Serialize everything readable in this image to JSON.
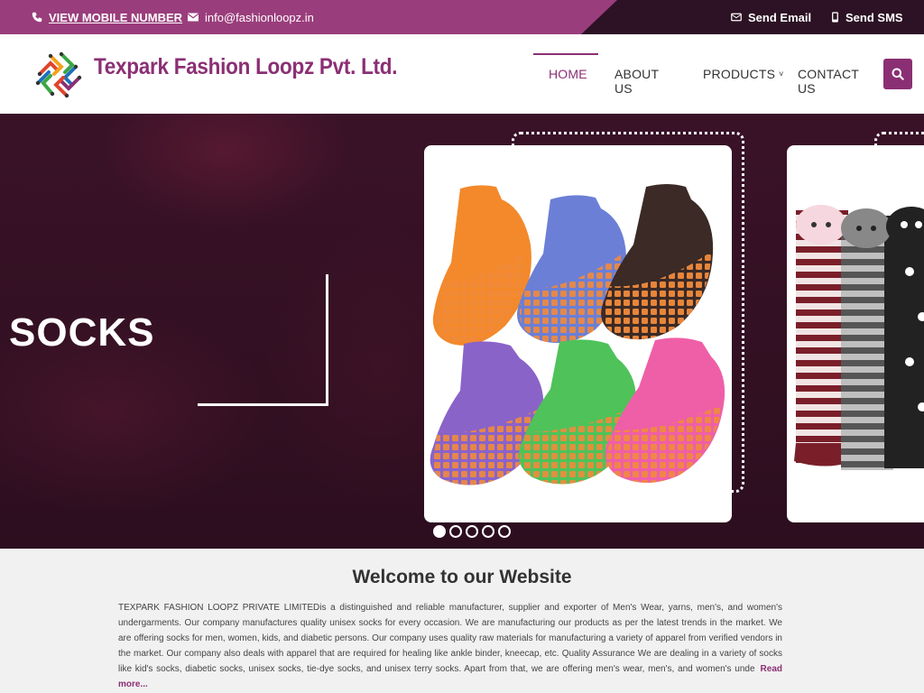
{
  "topbar": {
    "mobile_label": "VIEW MOBILE NUMBER",
    "email": "info@fashionloopz.in",
    "send_email": "Send Email",
    "send_sms": "Send SMS"
  },
  "header": {
    "brand": "Texpark Fashion Loopz Pvt. Ltd.",
    "nav": [
      {
        "label": "HOME",
        "active": true
      },
      {
        "label": "ABOUT US"
      },
      {
        "label": "PRODUCTS",
        "has_dropdown": true
      },
      {
        "label": "CONTACT US"
      }
    ],
    "caret": "˅"
  },
  "hero": {
    "title": "SOCKS",
    "slides": 5,
    "active_slide": 1
  },
  "welcome": {
    "title": "Welcome to our Website",
    "body": "TEXPARK FASHION LOOPZ PRIVATE LIMITEDis a distinguished and reliable manufacturer, supplier and exporter of Men's Wear, yarns, men's, and women's undergarments. Our company manufactures quality unisex socks for every occasion.  We are manufacturing our products as per the latest trends in the market. We are offering socks for men, women, kids, and diabetic persons. Our company uses quality raw materials for manufacturing a variety of apparel from verified vendors in the market. Our company also deals with apparel that are required for healing like ankle binder, kneecap, etc. Quality Assurance We are dealing in a variety of socks like kid's socks, diabetic socks, unisex socks, tie-dye socks, and unisex terry socks. Apart from that, we are offering men's wear, men's, and women's unde",
    "read_more": "Read more..."
  },
  "colors": {
    "brand": "#8b2f74",
    "topbar": "#9a3d7c",
    "topbar_dark": "#2c1224",
    "hero_bg": "#3b1428"
  }
}
